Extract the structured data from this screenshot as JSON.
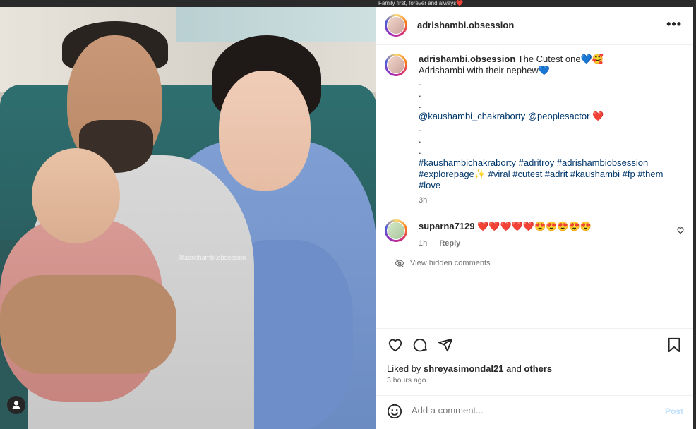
{
  "backdrop": {
    "caption": "Family first, forever and always❤️"
  },
  "photo": {
    "watermark": "@adrishambi.obsession"
  },
  "header": {
    "username": "adrishambi.obsession",
    "more": "•••"
  },
  "caption": {
    "username": "adrishambi.obsession",
    "line1": "The Cutest one💙🥰",
    "line2": "Adrishambi with their nephew💙",
    "dots1": [
      ".",
      ".",
      "."
    ],
    "mentions": "@kaushambi_chakraborty @peoplesactor",
    "mentions_emoji": "❤️",
    "dots2": [
      ".",
      ".",
      "."
    ],
    "hashtags_line1": "#kaushambichakraborty #adritroy #adrishambiobsession",
    "hashtags_line2_a": "#explorepage",
    "hashtags_line2_emoji": "✨",
    "hashtags_line2_b": " #viral #cutest #adrit #kaushambi #fp #them",
    "hashtags_line3": "#love",
    "time": "3h"
  },
  "comment": {
    "username": "suparna7129",
    "text": "❤️❤️❤️❤️❤️😍😍😍😍😍",
    "time": "1h",
    "reply": "Reply"
  },
  "hidden_comments": "View hidden comments",
  "likes": {
    "prefix": "Liked by ",
    "user": "shreyasimondal21",
    "and": " and ",
    "others": "others"
  },
  "posted": "3 hours ago",
  "comment_box": {
    "placeholder": "Add a comment...",
    "post": "Post"
  },
  "colors": {
    "link": "#00376b",
    "post_disabled": "#c0dffd",
    "text": "#262626",
    "muted": "#737373"
  }
}
